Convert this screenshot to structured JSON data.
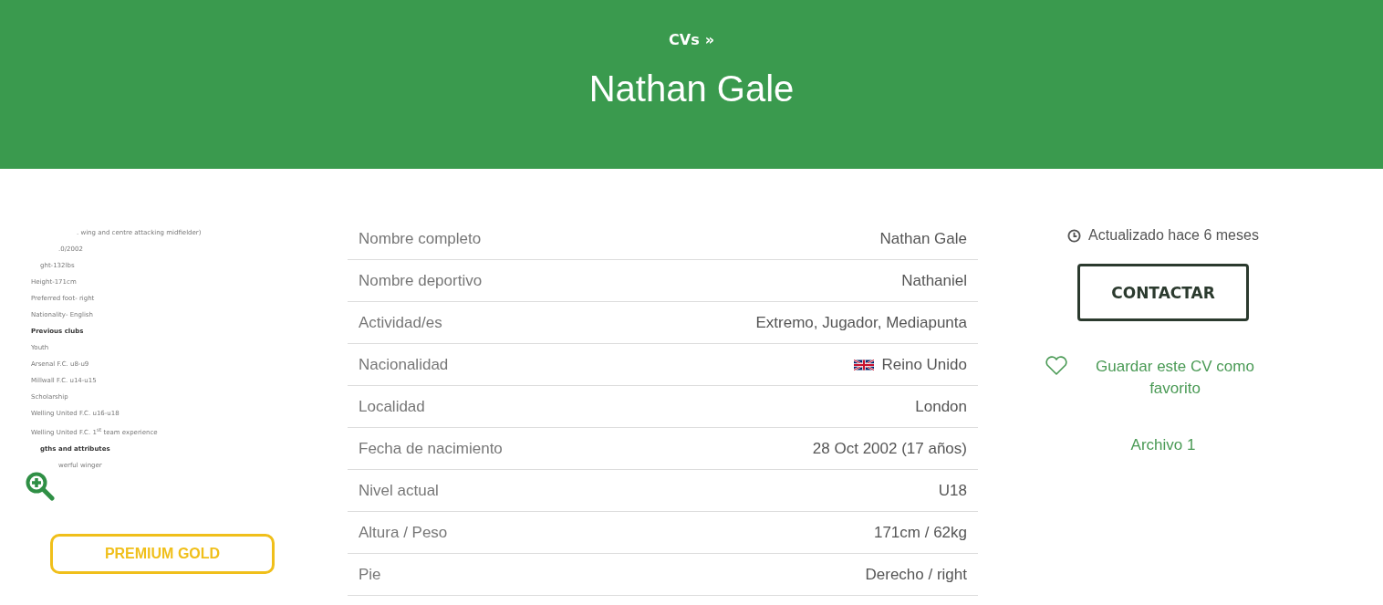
{
  "header": {
    "breadcrumb": "CVs",
    "breadcrumb_separator": "»",
    "title": "Nathan Gale"
  },
  "cv_preview": {
    "lines": [
      {
        "text": ". wing and centre attacking midfielder)",
        "kind": "text"
      },
      {
        "text": ".0/2002",
        "kind": "text"
      },
      {
        "text": "ght-132lbs",
        "kind": "text"
      },
      {
        "text": "Height-171cm",
        "kind": "text"
      },
      {
        "text": "Preferred foot- right",
        "kind": "text"
      },
      {
        "text": "Nationality- English",
        "kind": "text"
      },
      {
        "text": "Previous clubs",
        "kind": "heading"
      },
      {
        "text": "Youth",
        "kind": "text"
      },
      {
        "text": "Arsenal F.C. u8-u9",
        "kind": "text"
      },
      {
        "text": "Millwall F.C. u14-u15",
        "kind": "text"
      },
      {
        "text": "Scholarship",
        "kind": "text"
      },
      {
        "text": "Welling United F.C. u16-u18",
        "kind": "text"
      },
      {
        "text": "Welling United F.C. 1$^{st}$ team experience",
        "kind": "text"
      },
      {
        "text": "gths and attributes",
        "kind": "heading"
      },
      {
        "text": "werful winger",
        "kind": "text"
      }
    ],
    "badge": "PREMIUM GOLD"
  },
  "details": [
    {
      "label": "Nombre completo",
      "value": "Nathan Gale"
    },
    {
      "label": "Nombre deportivo",
      "value": "Nathaniel"
    },
    {
      "label": "Actividad/es",
      "value": "Extremo, Jugador, Mediapunta"
    },
    {
      "label": "Nacionalidad",
      "value": "Reino Unido",
      "kind": "flag"
    },
    {
      "label": "Localidad",
      "value": "London"
    },
    {
      "label": "Fecha de nacimiento",
      "value": "28 Oct 2002 (17 años)"
    },
    {
      "label": "Nivel actual",
      "value": "U18"
    },
    {
      "label": "Altura / Peso",
      "value": "171cm / 62kg"
    },
    {
      "label": "Pie",
      "value": "Derecho / right"
    }
  ],
  "sidebar": {
    "updated": "Actualizado hace 6 meses",
    "contact_button": "CONTACTAR",
    "favorite": "Guardar este CV como favorito",
    "file_link": "Archivo 1"
  }
}
